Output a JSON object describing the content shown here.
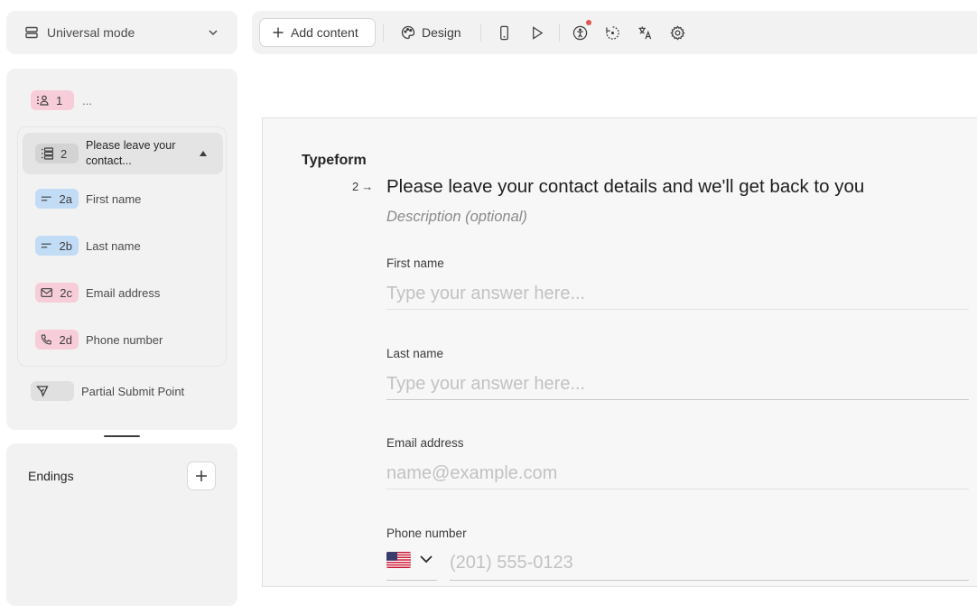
{
  "mode_selector": {
    "label": "Universal mode",
    "icon": "layers-icon"
  },
  "outline": {
    "q1": {
      "number": "1",
      "title": "...",
      "icon": "contact-info-icon",
      "color": "#f6cdd8"
    },
    "group": {
      "number": "2",
      "title": "Please leave your contact...",
      "icon": "multi-question-icon"
    },
    "sub_items": [
      {
        "number": "2a",
        "label": "First name",
        "icon": "short-text-icon",
        "color": "#c2dcf6"
      },
      {
        "number": "2b",
        "label": "Last name",
        "icon": "short-text-icon",
        "color": "#c2dcf6"
      },
      {
        "number": "2c",
        "label": "Email address",
        "icon": "envelope-icon",
        "color": "#f6cdd8"
      },
      {
        "number": "2d",
        "label": "Phone number",
        "icon": "phone-icon",
        "color": "#f6cdd8"
      }
    ],
    "partial_submit": {
      "label": "Partial Submit Point",
      "icon": "send-icon"
    }
  },
  "endings": {
    "title": "Endings",
    "add_icon": "plus-icon"
  },
  "toolbar": {
    "add_content_label": "Add content",
    "design_label": "Design",
    "icons": [
      "mobile-preview-icon",
      "play-icon",
      "accessibility-icon",
      "logic-icon",
      "translate-icon",
      "settings-icon"
    ],
    "notification_color": "#e0584c"
  },
  "form": {
    "brand": "Typeform",
    "question_number": "2",
    "question_arrow": "→",
    "question_title": "Please leave your contact details and we'll get back to you",
    "description_placeholder": "Description (optional)",
    "fields": [
      {
        "label": "First name",
        "placeholder": "Type your answer here..."
      },
      {
        "label": "Last name",
        "placeholder": "Type your answer here..."
      },
      {
        "label": "Email address",
        "placeholder": "name@example.com"
      },
      {
        "label": "Phone number",
        "placeholder": "(201) 555-0123",
        "country": "US"
      }
    ]
  }
}
